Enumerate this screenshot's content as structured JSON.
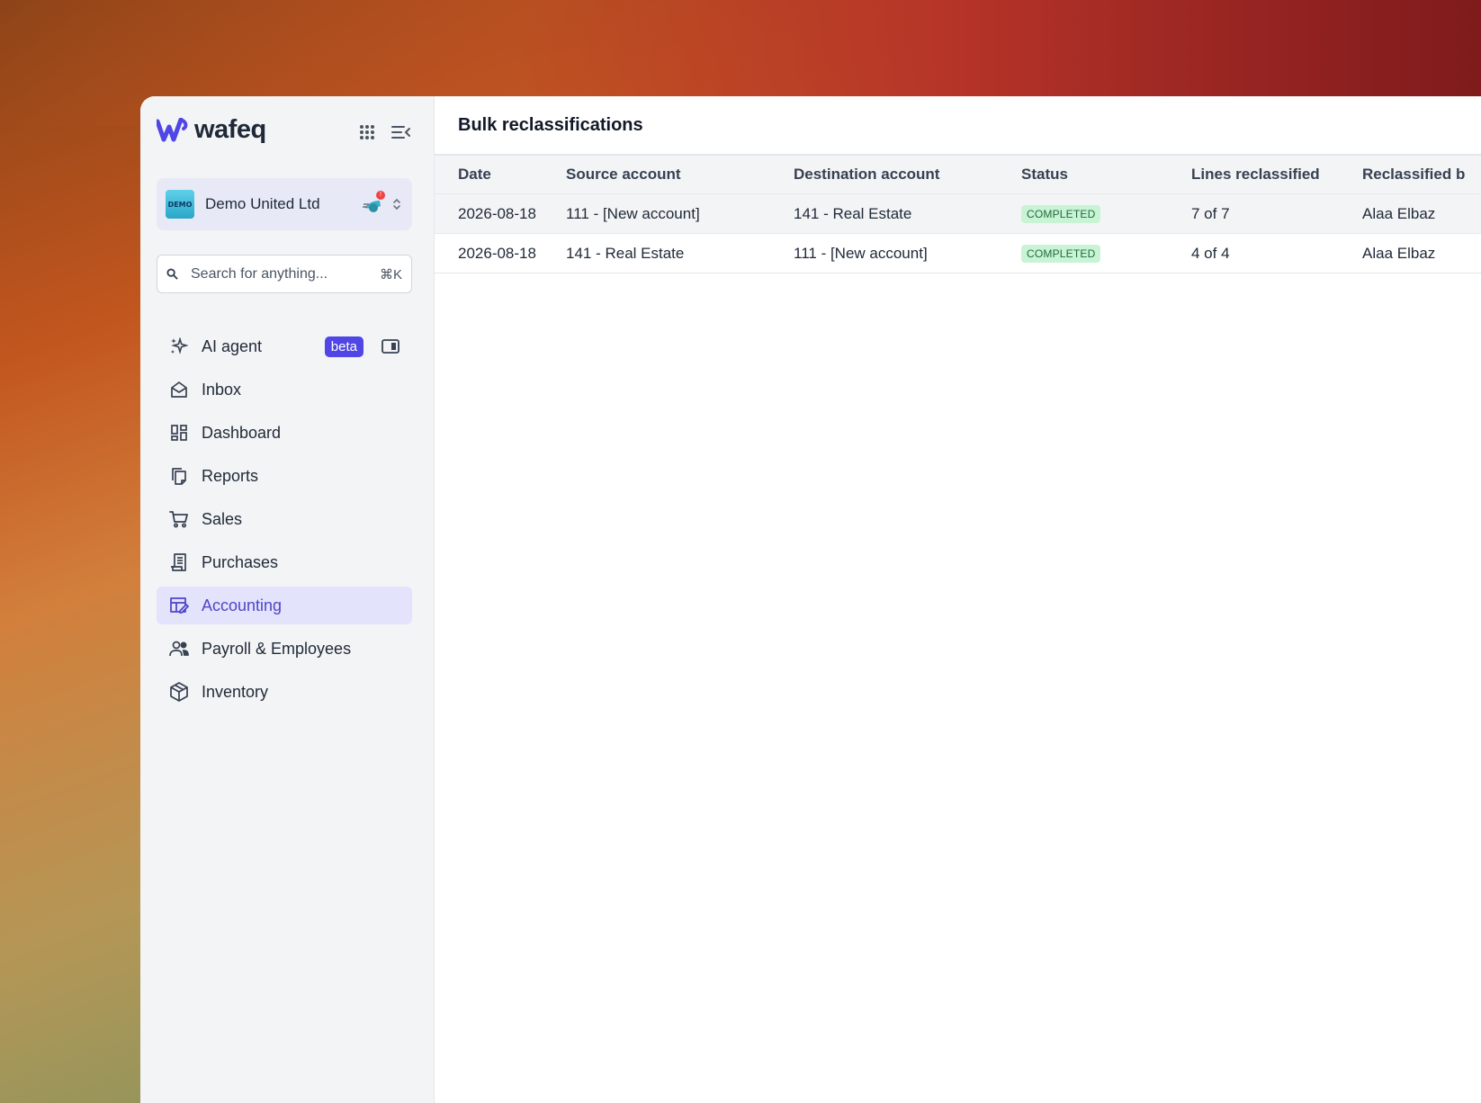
{
  "app": {
    "brand_name": "wafeq"
  },
  "org": {
    "logo_text": "DEMO",
    "name": "Demo United Ltd",
    "notification_count": "!"
  },
  "search": {
    "placeholder": "Search for anything...",
    "shortcut": "⌘K"
  },
  "nav": {
    "items": [
      {
        "label": "AI agent",
        "icon": "sparkles-icon",
        "badge": "beta"
      },
      {
        "label": "Inbox",
        "icon": "inbox-icon"
      },
      {
        "label": "Dashboard",
        "icon": "dashboard-icon"
      },
      {
        "label": "Reports",
        "icon": "reports-icon"
      },
      {
        "label": "Sales",
        "icon": "cart-icon"
      },
      {
        "label": "Purchases",
        "icon": "receipt-icon"
      },
      {
        "label": "Accounting",
        "icon": "ledger-icon",
        "active": true
      },
      {
        "label": "Payroll & Employees",
        "icon": "users-icon"
      },
      {
        "label": "Inventory",
        "icon": "box-icon"
      }
    ]
  },
  "page": {
    "title": "Bulk reclassifications"
  },
  "table": {
    "columns": [
      "Date",
      "Source account",
      "Destination account",
      "Status",
      "Lines reclassified",
      "Reclassified b"
    ],
    "rows": [
      [
        "2026-08-18",
        "111 - [New account]",
        "141 - Real Estate",
        "COMPLETED",
        "7 of 7",
        "Alaa Elbaz"
      ],
      [
        "2026-08-18",
        "141 - Real Estate",
        "111 - [New account]",
        "COMPLETED",
        "4 of 4",
        "Alaa Elbaz"
      ]
    ]
  },
  "colors": {
    "accent": "#4f46e5",
    "active_nav_bg": "#e3e3fb",
    "status_completed_bg": "#c9f3d5",
    "status_completed_text": "#1f6b3a"
  }
}
